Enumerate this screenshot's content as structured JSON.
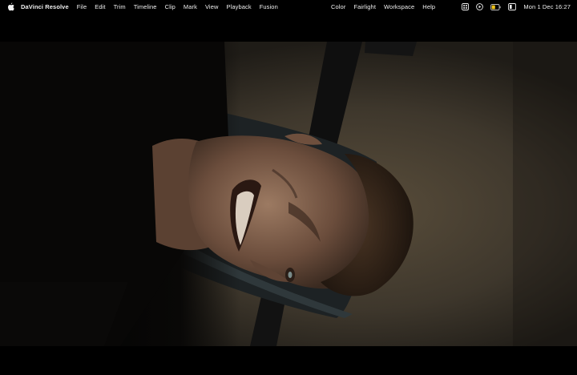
{
  "menubar": {
    "app_name": "DaVinci Resolve",
    "menus": [
      "File",
      "Edit",
      "Trim",
      "Timeline",
      "Clip",
      "Mark",
      "View",
      "Playback",
      "Fusion"
    ],
    "menus_right": [
      "Color",
      "Fairlight",
      "Workspace",
      "Help"
    ],
    "status_icons": [
      "control-center-icon",
      "play-icon",
      "battery-icon",
      "wifi-icon"
    ],
    "clock": "Mon 1 Dec  16:27"
  },
  "colors": {
    "menubar_bg": "#000000",
    "battery_fill": "#f0c419"
  }
}
